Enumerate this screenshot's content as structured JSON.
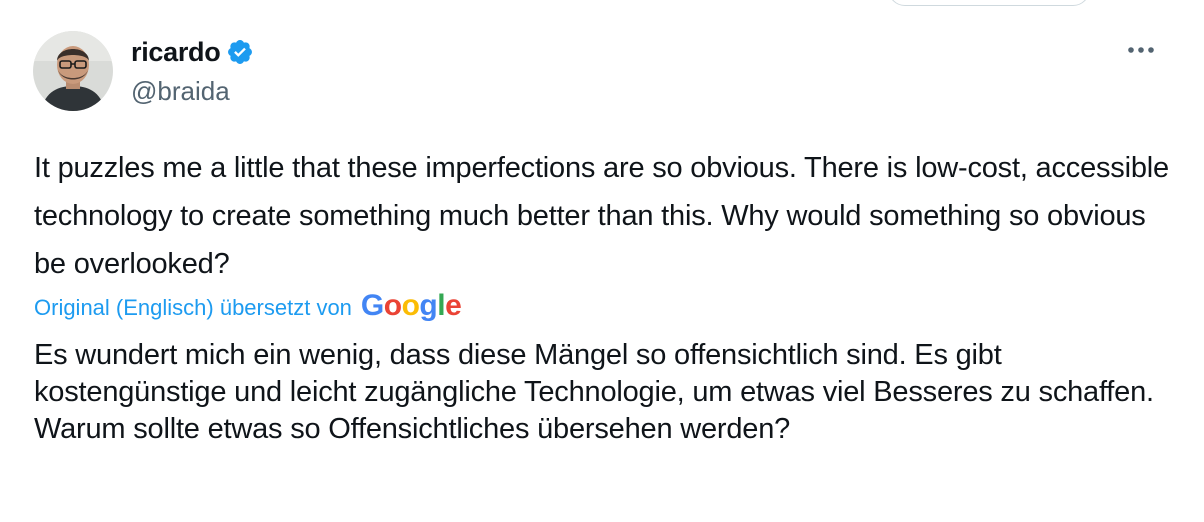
{
  "tweet": {
    "author": {
      "display_name": "ricardo",
      "handle": "@braida",
      "verified": true,
      "verified_icon": "verified-badge-icon",
      "avatar_icon": "avatar-photo"
    },
    "more_icon": "more-horizontal-icon",
    "original_text": "It puzzles me a little that these imperfections are so obvious. There is low-cost, accessible technology to create something much better than this. Why would something so obvious be overlooked?",
    "translation": {
      "label": "Original (Englisch) übersetzt von",
      "provider": "Google",
      "text": "Es wundert mich ein wenig, dass diese Mängel so offensichtlich sind. Es gibt kostengünstige und leicht zugängliche Technologie, um etwas viel Besseres zu schaffen. Warum sollte etwas so Offensichtliches übersehen werden?"
    }
  },
  "colors": {
    "text": "#0f1419",
    "secondary": "#536471",
    "accent": "#1d9bf0",
    "google_blue": "#4285f4",
    "google_red": "#ea4335",
    "google_yellow": "#fbbc05",
    "google_green": "#34a853"
  }
}
